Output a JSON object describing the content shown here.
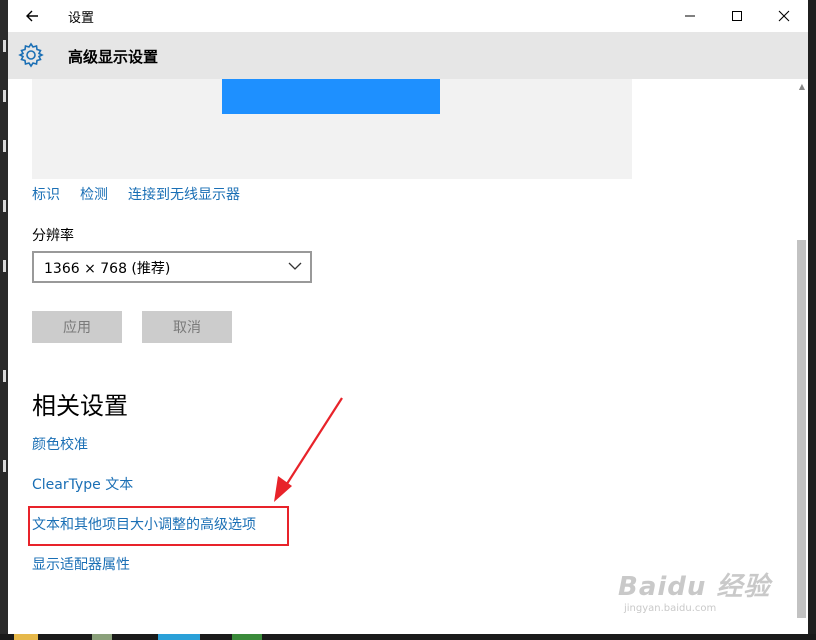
{
  "window": {
    "title": "设置"
  },
  "header": {
    "title": "高级显示设置"
  },
  "display_links": [
    "标识",
    "检测",
    "连接到无线显示器"
  ],
  "resolution": {
    "label": "分辨率",
    "value": "1366 × 768 (推荐)"
  },
  "buttons": {
    "apply": "应用",
    "cancel": "取消"
  },
  "related": {
    "title": "相关设置",
    "items": [
      "颜色校准",
      "ClearType 文本",
      "文本和其他项目大小调整的高级选项",
      "显示适配器属性"
    ]
  },
  "watermark": {
    "main": "Baidu 经验",
    "sub": "jingyan.baidu.com"
  },
  "colors": {
    "link": "#1a6fb5",
    "monitor": "#1e90ff",
    "highlight": "#e8232a",
    "header_bg": "#e6e6e6"
  },
  "icons": [
    "back-arrow-icon",
    "minimize-icon",
    "maximize-icon",
    "close-icon",
    "gear-icon",
    "chevron-down-icon"
  ]
}
